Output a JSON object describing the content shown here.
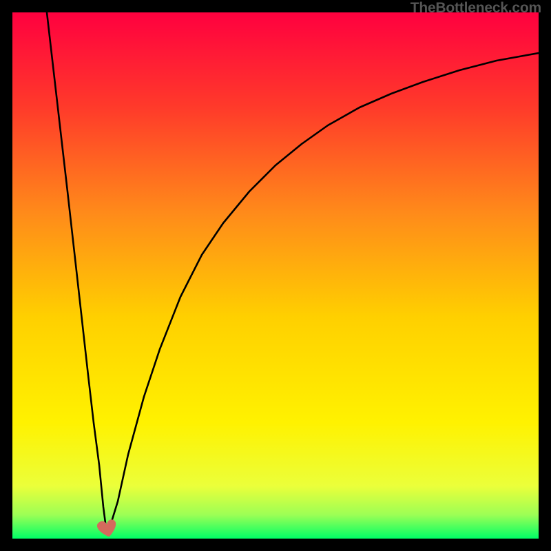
{
  "watermark": {
    "text": "TheBottleneck.com"
  },
  "chart_data": {
    "type": "line",
    "title": "",
    "xlabel": "",
    "ylabel": "",
    "xlim": [
      0,
      100
    ],
    "ylim": [
      0,
      100
    ],
    "grid": false,
    "legend": false,
    "background_gradient": {
      "top_color": "#ff003f",
      "middle_color": "#ffe000",
      "bottom_color": "#00ff66"
    },
    "series": [
      {
        "name": "left-branch",
        "x": [
          6.5,
          8.5,
          10.5,
          12.5,
          14.5,
          15.5,
          16.5,
          17.3,
          17.8
        ],
        "values": [
          100,
          83,
          66,
          48.5,
          31,
          22,
          14,
          6,
          2
        ]
      },
      {
        "name": "right-branch",
        "x": [
          18.5,
          20,
          22,
          25,
          28,
          32,
          36,
          40,
          45,
          50,
          55,
          60,
          66,
          72,
          78,
          85,
          92,
          100
        ],
        "values": [
          2,
          7,
          16,
          27,
          36,
          46,
          54,
          60,
          66,
          71,
          75,
          78.5,
          82,
          84.5,
          86.8,
          89,
          90.8,
          92.3
        ]
      }
    ],
    "marker": {
      "name": "bottleneck-heart",
      "x": 18,
      "y": 1.5,
      "glyph": "heart",
      "color": "#d46a5d"
    }
  },
  "colors": {
    "frame": "#000000",
    "curve": "#000000",
    "gradient_top": "#ff003f",
    "gradient_mid_upper": "#ff6a1e",
    "gradient_mid": "#ffe000",
    "gradient_mid_lower": "#f7ff4a",
    "gradient_bottom": "#00ff66",
    "heart": "#d46a5d",
    "watermark": "#555555"
  }
}
